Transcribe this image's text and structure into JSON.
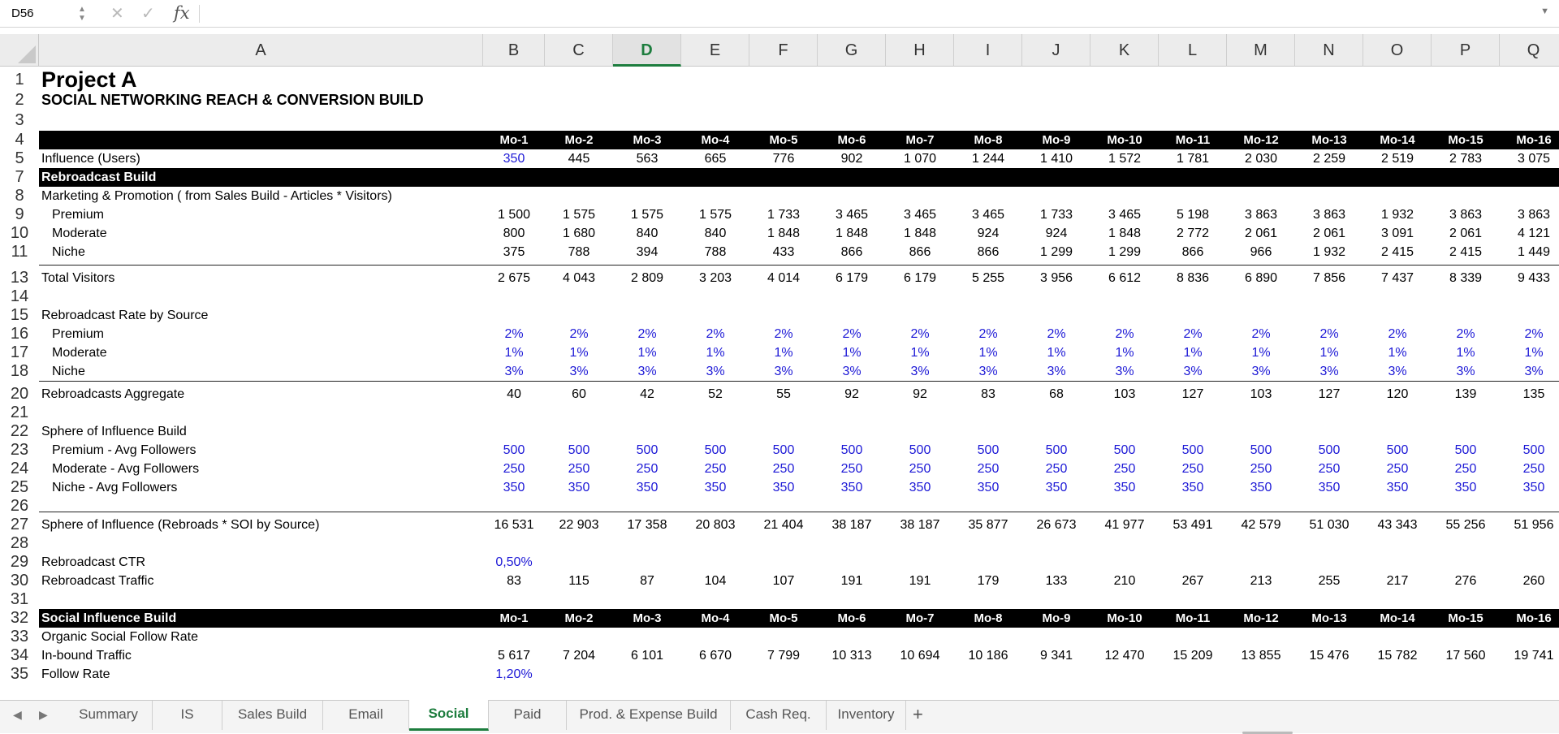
{
  "formula_bar": {
    "cell_ref": "D56",
    "cancel_icon": "✕",
    "enter_icon": "✓",
    "fx_label": "fx",
    "formula": ""
  },
  "columns": [
    {
      "name": "A",
      "selected": false
    },
    {
      "name": "B",
      "selected": false
    },
    {
      "name": "C",
      "selected": false
    },
    {
      "name": "D",
      "selected": true
    },
    {
      "name": "E",
      "selected": false
    },
    {
      "name": "F",
      "selected": false
    },
    {
      "name": "G",
      "selected": false
    },
    {
      "name": "H",
      "selected": false
    },
    {
      "name": "I",
      "selected": false
    },
    {
      "name": "J",
      "selected": false
    },
    {
      "name": "K",
      "selected": false
    },
    {
      "name": "L",
      "selected": false
    },
    {
      "name": "M",
      "selected": false
    },
    {
      "name": "N",
      "selected": false
    },
    {
      "name": "O",
      "selected": false
    },
    {
      "name": "P",
      "selected": false
    },
    {
      "name": "Q",
      "selected": false
    }
  ],
  "rows": [
    {
      "num": "1",
      "style": "title",
      "a": "Project A"
    },
    {
      "num": "2",
      "style": "subtitle",
      "a": "SOCIAL NETWORKING REACH & CONVERSION BUILD"
    },
    {
      "num": "3"
    },
    {
      "num": "4",
      "style": "dark",
      "a": "",
      "values": [
        "Mo-1",
        "Mo-2",
        "Mo-3",
        "Mo-4",
        "Mo-5",
        "Mo-6",
        "Mo-7",
        "Mo-8",
        "Mo-9",
        "Mo-10",
        "Mo-11",
        "Mo-12",
        "Mo-13",
        "Mo-14",
        "Mo-15",
        "Mo-16"
      ]
    },
    {
      "num": "5",
      "a": "Influence (Users)",
      "values": [
        "350",
        "445",
        "563",
        "665",
        "776",
        "902",
        "1 070",
        "1 244",
        "1 410",
        "1 572",
        "1 781",
        "2 030",
        "2 259",
        "2 519",
        "2 783",
        "3 075"
      ],
      "blue_first": true
    },
    {
      "num": "7",
      "style": "dark",
      "a": "Rebroadcast Build"
    },
    {
      "num": "8",
      "a": "Marketing & Promotion ( from Sales Build - Articles * Visitors)"
    },
    {
      "num": "9",
      "indent": true,
      "a": "Premium",
      "values": [
        "1 500",
        "1 575",
        "1 575",
        "1 575",
        "1 733",
        "3 465",
        "3 465",
        "3 465",
        "1 733",
        "3 465",
        "5 198",
        "3 863",
        "3 863",
        "1 932",
        "3 863",
        "3 863"
      ]
    },
    {
      "num": "10",
      "indent": true,
      "a": "Moderate",
      "values": [
        "800",
        "1 680",
        "840",
        "840",
        "1 848",
        "1 848",
        "1 848",
        "924",
        "924",
        "1 848",
        "2 772",
        "2 061",
        "2 061",
        "3 091",
        "2 061",
        "4 121"
      ]
    },
    {
      "num": "11",
      "indent": true,
      "a": "Niche",
      "values": [
        "375",
        "788",
        "394",
        "788",
        "433",
        "866",
        "866",
        "866",
        "1 299",
        "1 299",
        "866",
        "966",
        "1 932",
        "2 415",
        "2 415",
        "1 449"
      ]
    },
    {
      "num": "13",
      "a": "Total Visitors",
      "line_above": true,
      "values": [
        "2 675",
        "4 043",
        "2 809",
        "3 203",
        "4 014",
        "6 179",
        "6 179",
        "5 255",
        "3 956",
        "6 612",
        "8 836",
        "6 890",
        "7 856",
        "7 437",
        "8 339",
        "9 433"
      ]
    },
    {
      "num": "14"
    },
    {
      "num": "15",
      "a": "Rebroadcast Rate by Source"
    },
    {
      "num": "16",
      "indent": true,
      "a": "Premium",
      "blue": true,
      "values": [
        "2%",
        "2%",
        "2%",
        "2%",
        "2%",
        "2%",
        "2%",
        "2%",
        "2%",
        "2%",
        "2%",
        "2%",
        "2%",
        "2%",
        "2%",
        "2%"
      ]
    },
    {
      "num": "17",
      "indent": true,
      "a": "Moderate",
      "blue": true,
      "values": [
        "1%",
        "1%",
        "1%",
        "1%",
        "1%",
        "1%",
        "1%",
        "1%",
        "1%",
        "1%",
        "1%",
        "1%",
        "1%",
        "1%",
        "1%",
        "1%"
      ]
    },
    {
      "num": "18",
      "indent": true,
      "a": "Niche",
      "blue": true,
      "values": [
        "3%",
        "3%",
        "3%",
        "3%",
        "3%",
        "3%",
        "3%",
        "3%",
        "3%",
        "3%",
        "3%",
        "3%",
        "3%",
        "3%",
        "3%",
        "3%"
      ]
    },
    {
      "num": "20",
      "a": "Rebroadcasts Aggregate",
      "line_above": true,
      "values": [
        "40",
        "60",
        "42",
        "52",
        "55",
        "92",
        "92",
        "83",
        "68",
        "103",
        "127",
        "103",
        "127",
        "120",
        "139",
        "135"
      ]
    },
    {
      "num": "21"
    },
    {
      "num": "22",
      "a": "Sphere of Influence Build"
    },
    {
      "num": "23",
      "indent": true,
      "a": "Premium - Avg Followers",
      "blue": true,
      "values": [
        "500",
        "500",
        "500",
        "500",
        "500",
        "500",
        "500",
        "500",
        "500",
        "500",
        "500",
        "500",
        "500",
        "500",
        "500",
        "500"
      ]
    },
    {
      "num": "24",
      "indent": true,
      "a": "Moderate - Avg Followers",
      "blue": true,
      "values": [
        "250",
        "250",
        "250",
        "250",
        "250",
        "250",
        "250",
        "250",
        "250",
        "250",
        "250",
        "250",
        "250",
        "250",
        "250",
        "250"
      ]
    },
    {
      "num": "25",
      "indent": true,
      "a": "Niche - Avg Followers",
      "blue": true,
      "values": [
        "350",
        "350",
        "350",
        "350",
        "350",
        "350",
        "350",
        "350",
        "350",
        "350",
        "350",
        "350",
        "350",
        "350",
        "350",
        "350"
      ]
    },
    {
      "num": "26"
    },
    {
      "num": "27",
      "a": "Sphere of Influence (Rebroads * SOI by Source)",
      "line_above": true,
      "values": [
        "16 531",
        "22 903",
        "17 358",
        "20 803",
        "21 404",
        "38 187",
        "38 187",
        "35 877",
        "26 673",
        "41 977",
        "53 491",
        "42 579",
        "51 030",
        "43 343",
        "55 256",
        "51 956"
      ]
    },
    {
      "num": "28"
    },
    {
      "num": "29",
      "a": "Rebroadcast CTR",
      "blue": true,
      "values": [
        "0,50%"
      ]
    },
    {
      "num": "30",
      "a": "Rebroadcast Traffic",
      "values": [
        "83",
        "115",
        "87",
        "104",
        "107",
        "191",
        "191",
        "179",
        "133",
        "210",
        "267",
        "213",
        "255",
        "217",
        "276",
        "260"
      ]
    },
    {
      "num": "31"
    },
    {
      "num": "32",
      "style": "dark",
      "a": "Social Influence Build",
      "values": [
        "Mo-1",
        "Mo-2",
        "Mo-3",
        "Mo-4",
        "Mo-5",
        "Mo-6",
        "Mo-7",
        "Mo-8",
        "Mo-9",
        "Mo-10",
        "Mo-11",
        "Mo-12",
        "Mo-13",
        "Mo-14",
        "Mo-15",
        "Mo-16"
      ]
    },
    {
      "num": "33",
      "a": "Organic Social Follow Rate"
    },
    {
      "num": "34",
      "a": "In-bound Traffic",
      "values": [
        "5 617",
        "7 204",
        "6 101",
        "6 670",
        "7 799",
        "10 313",
        "10 694",
        "10 186",
        "9 341",
        "12 470",
        "15 209",
        "13 855",
        "15 476",
        "15 782",
        "17 560",
        "19 741"
      ]
    },
    {
      "num": "35",
      "a": "Follow Rate",
      "blue": true,
      "values": [
        "1,20%"
      ]
    }
  ],
  "tabs": [
    {
      "label": "Summary",
      "active": false
    },
    {
      "label": "IS",
      "active": false
    },
    {
      "label": "Sales Build",
      "active": false
    },
    {
      "label": "Email",
      "active": false
    },
    {
      "label": "Social",
      "active": true
    },
    {
      "label": "Paid",
      "active": false
    },
    {
      "label": "Prod. & Expense Build",
      "active": false
    },
    {
      "label": "Cash Req.",
      "active": false
    },
    {
      "label": "Inventory",
      "active": false
    }
  ],
  "add_sheet_label": "+",
  "colors": {
    "accent": "#1d7d3e",
    "input_blue": "#1c18d6",
    "header_bg": "#000000"
  }
}
